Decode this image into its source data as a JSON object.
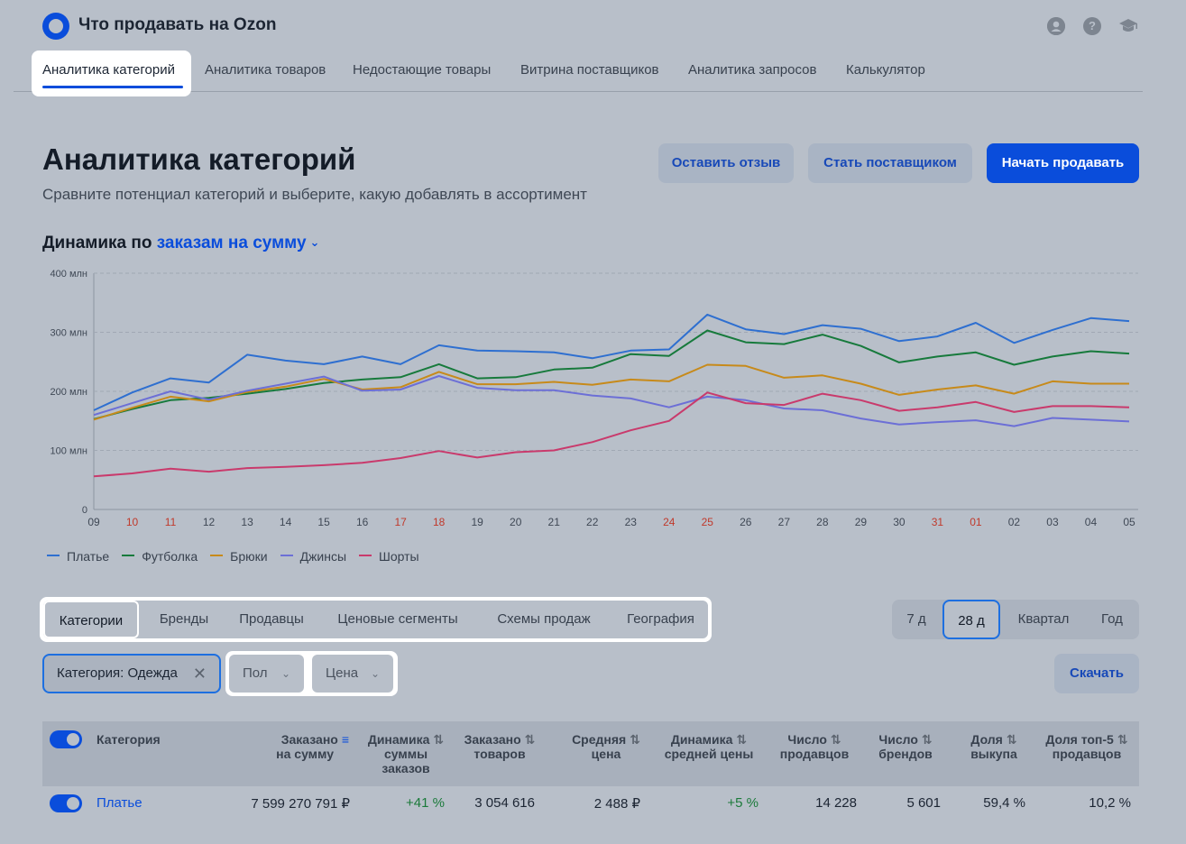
{
  "header": {
    "app_title": "Что продавать на Ozon",
    "icons": [
      "user-icon",
      "help-icon",
      "education-icon"
    ]
  },
  "nav": {
    "tabs": [
      {
        "label": "Аналитика категорий",
        "active": true
      },
      {
        "label": "Аналитика товаров"
      },
      {
        "label": "Недостающие товары"
      },
      {
        "label": "Витрина поставщиков"
      },
      {
        "label": "Аналитика запросов"
      },
      {
        "label": "Калькулятор"
      }
    ]
  },
  "page": {
    "title": "Аналитика категорий",
    "subtitle": "Сравните потенциал категорий и выберите, какую добавлять в ассортимент",
    "buttons": {
      "feedback": "Оставить отзыв",
      "supplier": "Стать поставщиком",
      "start": "Начать продавать"
    }
  },
  "dynamics": {
    "prefix": "Динамика по",
    "metric": "заказам на сумму"
  },
  "colors": {
    "accent": "#0a4ddb",
    "positive": "#1b7a3a",
    "weekend_tick": "#c0392b"
  },
  "chart_data": {
    "type": "line",
    "x": [
      "09",
      "10",
      "11",
      "12",
      "13",
      "14",
      "15",
      "16",
      "17",
      "18",
      "19",
      "20",
      "21",
      "22",
      "23",
      "24",
      "25",
      "26",
      "27",
      "28",
      "29",
      "30",
      "31",
      "01",
      "02",
      "03",
      "04",
      "05"
    ],
    "weekend_ticks": [
      "10",
      "11",
      "17",
      "18",
      "24",
      "25",
      "31",
      "01"
    ],
    "y_ticks": [
      "0",
      "100 млн",
      "200 млн",
      "300 млн",
      "400 млн"
    ],
    "ylim": [
      0,
      400
    ],
    "y_unit": "млн",
    "grid": true,
    "legend_position": "bottom-left",
    "series": [
      {
        "name": "Платье",
        "color": "#2e6fd0",
        "values": [
          168,
          198,
          222,
          215,
          262,
          252,
          246,
          259,
          246,
          278,
          269,
          268,
          266,
          256,
          269,
          271,
          330,
          305,
          297,
          312,
          306,
          285,
          293,
          316,
          282,
          304,
          324,
          319
        ]
      },
      {
        "name": "Футболка",
        "color": "#177a3c",
        "values": [
          153,
          170,
          185,
          189,
          196,
          204,
          214,
          220,
          224,
          246,
          222,
          224,
          237,
          240,
          263,
          260,
          303,
          283,
          280,
          296,
          277,
          249,
          259,
          266,
          245,
          259,
          268,
          264
        ]
      },
      {
        "name": "Брюки",
        "color": "#c78a1a",
        "values": [
          152,
          172,
          191,
          183,
          199,
          208,
          221,
          203,
          207,
          233,
          212,
          212,
          216,
          211,
          220,
          217,
          245,
          243,
          223,
          227,
          213,
          194,
          203,
          210,
          196,
          217,
          213,
          213
        ]
      },
      {
        "name": "Джинсы",
        "color": "#6c6fd6",
        "values": [
          160,
          180,
          200,
          186,
          201,
          213,
          225,
          201,
          203,
          226,
          206,
          202,
          202,
          193,
          188,
          173,
          191,
          185,
          171,
          168,
          154,
          144,
          148,
          151,
          141,
          155,
          152,
          149
        ]
      },
      {
        "name": "Шорты",
        "color": "#c93a6c",
        "values": [
          56,
          61,
          69,
          64,
          70,
          72,
          75,
          79,
          87,
          99,
          88,
          97,
          100,
          114,
          134,
          150,
          198,
          180,
          177,
          196,
          185,
          167,
          173,
          182,
          165,
          175,
          175,
          173
        ]
      }
    ]
  },
  "tabs": {
    "items": [
      "Категории",
      "Бренды",
      "Продавцы",
      "Ценовые сегменты",
      "Схемы продаж",
      "География"
    ],
    "active": "Категории"
  },
  "periods": {
    "items": [
      "7 д",
      "28 д",
      "Квартал",
      "Год"
    ],
    "active": "28 д"
  },
  "filters": {
    "chip_label": "Категория: Одежда",
    "dropdowns": [
      "Пол",
      "Цена"
    ],
    "download": "Скачать"
  },
  "table": {
    "headers": {
      "category": "Категория",
      "ordered_sum": [
        "Заказано",
        "на сумму"
      ],
      "sum_dynamics": [
        "Динамика",
        "суммы",
        "заказов"
      ],
      "ordered_items": [
        "Заказано",
        "товаров"
      ],
      "avg_price": [
        "Средняя",
        "цена"
      ],
      "price_dynamics": [
        "Динамика",
        "средней цены"
      ],
      "sellers": [
        "Число",
        "продавцов"
      ],
      "brands": [
        "Число",
        "брендов"
      ],
      "buyout": [
        "Доля",
        "выкупа"
      ],
      "top5": [
        "Доля топ-5",
        "продавцов"
      ]
    },
    "rows": [
      {
        "category": "Платье",
        "ordered_sum": "7 599 270 791 ₽",
        "sum_dynamics": "+41 %",
        "ordered_items": "3 054 616",
        "avg_price": "2 488 ₽",
        "price_dynamics": "+5 %",
        "sellers": "14 228",
        "brands": "5 601",
        "buyout": "59,4 %",
        "top5": "10,2 %"
      }
    ]
  }
}
